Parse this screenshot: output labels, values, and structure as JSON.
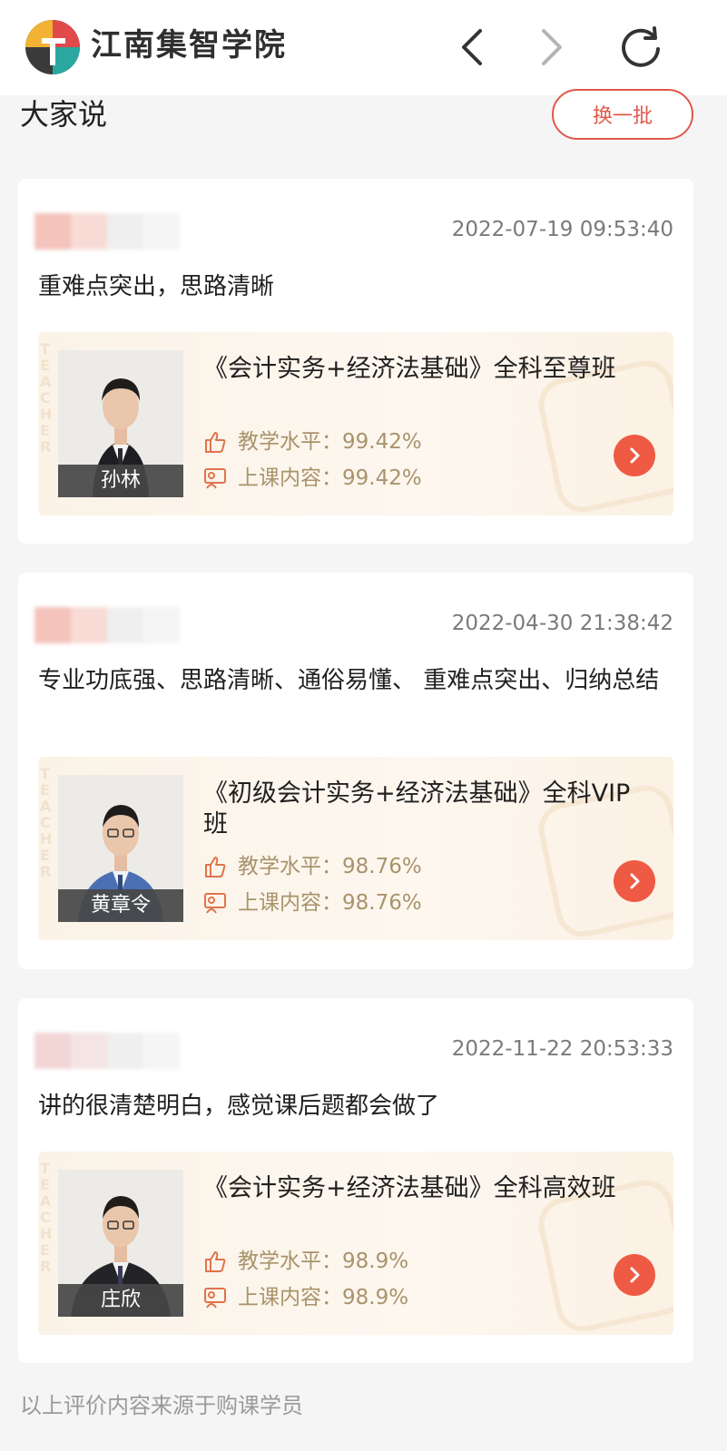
{
  "header": {
    "brand": "江南集智学院",
    "back_icon": "chevron-left-icon",
    "forward_icon": "chevron-right-icon",
    "refresh_icon": "refresh-icon"
  },
  "section": {
    "title": "大家说",
    "refresh_label": "换一批"
  },
  "reviews": [
    {
      "time": "2022-07-19 09:53:40",
      "comment": "重难点突出，思路清晰",
      "course": {
        "title": "《会计实务+经济法基础》全科至尊班",
        "teacher": "孙林",
        "teaching_level": "教学水平：99.42%",
        "content_rating": "上课内容：99.42%"
      }
    },
    {
      "time": "2022-04-30 21:38:42",
      "comment": "专业功底强、思路清晰、通俗易懂、 重难点突出、归纳总结",
      "course": {
        "title": "《初级会计实务+经济法基础》全科VIP班",
        "teacher": "黄章令",
        "teaching_level": "教学水平：98.76%",
        "content_rating": "上课内容：98.76%"
      }
    },
    {
      "time": "2022-11-22 20:53:33",
      "comment": "讲的很清楚明白，感觉课后题都会做了",
      "course": {
        "title": "《会计实务+经济法基础》全科高效班",
        "teacher": "庄欣",
        "teaching_level": "教学水平：98.9%",
        "content_rating": "上课内容：98.9%"
      }
    }
  ],
  "footer": {
    "note": "以上评价内容来源于购课学员"
  },
  "colors": {
    "accent": "#ef5a44",
    "stat_text": "#a9936c",
    "card_bg": "#fbf3e7"
  }
}
